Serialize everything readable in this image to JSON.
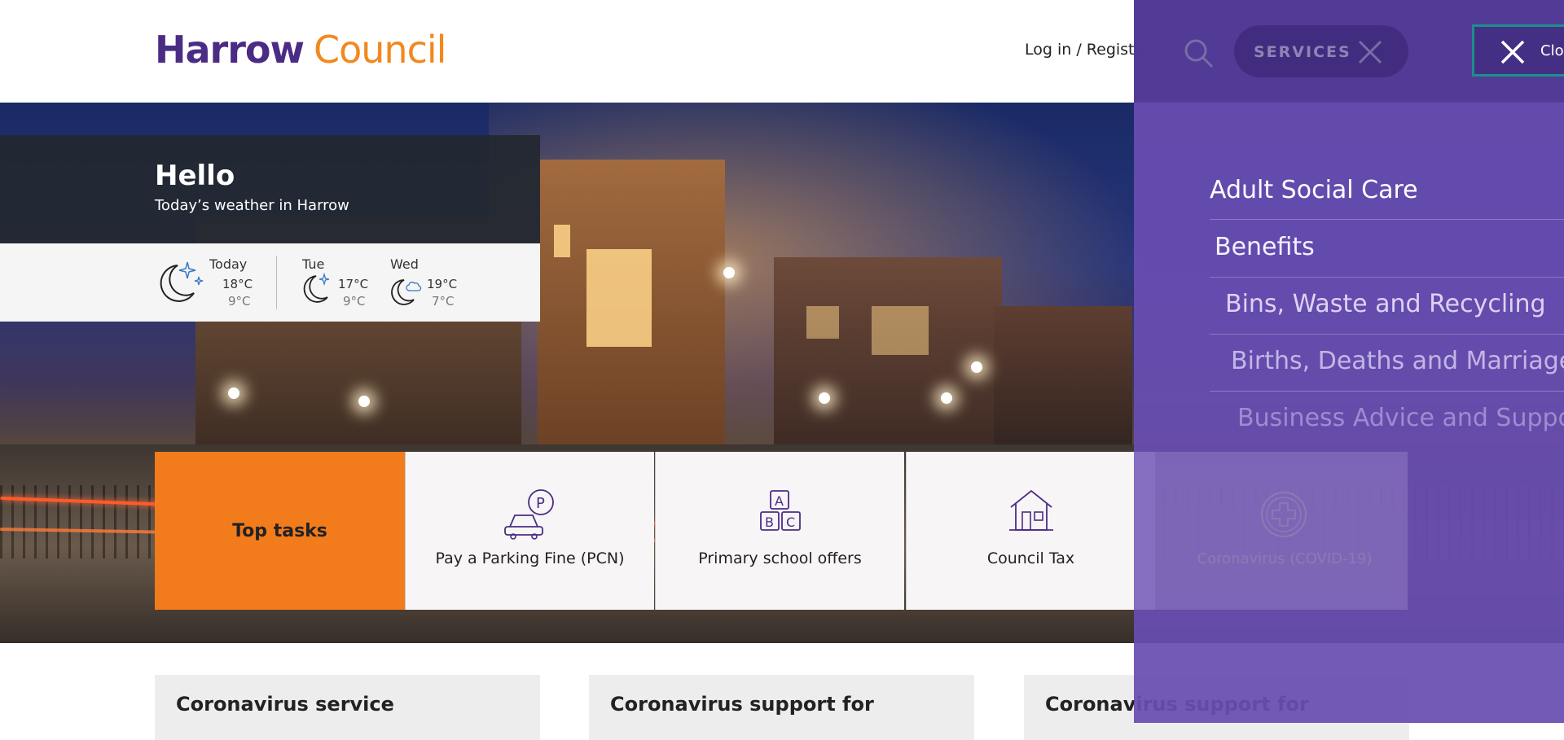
{
  "header": {
    "logo_harrow": "Harrow",
    "logo_council": "Council",
    "login": "Log in / Registe"
  },
  "greeting": {
    "title": "Hello",
    "subtitle": "Today’s weather in Harrow"
  },
  "weather": [
    {
      "day": "Today",
      "high": "18°C",
      "low": "9°C",
      "icon": "moon-stars-icon"
    },
    {
      "day": "Tue",
      "high": "17°C",
      "low": "9°C",
      "icon": "moon-stars-icon"
    },
    {
      "day": "Wed",
      "high": "19°C",
      "low": "7°C",
      "icon": "moon-cloud-icon"
    }
  ],
  "top_tasks": {
    "title": "Top tasks",
    "items": [
      {
        "label": "Pay a Parking Fine (PCN)",
        "icon": "parking-car-icon"
      },
      {
        "label": "Primary school offers",
        "icon": "abc-blocks-icon"
      },
      {
        "label": "Council Tax",
        "icon": "house-icon"
      },
      {
        "label": "Coronavirus (COVID-19)",
        "icon": "medical-cross-icon"
      }
    ]
  },
  "cards": [
    {
      "title": "Coronavirus service"
    },
    {
      "title": "Coronavirus support for"
    },
    {
      "title": "Coronavirus support for"
    }
  ],
  "services_menu": {
    "button_label": "SERVICES",
    "close_label": "Clo",
    "items": [
      "Adult Social Care",
      "Benefits",
      "Bins, Waste and Recycling",
      "Births, Deaths and Marriage",
      "Business Advice and Suppo"
    ]
  },
  "colors": {
    "brand_purple": "#4b2c85",
    "brand_orange": "#f2881e",
    "overlay_purple": "#684eb2",
    "top_tasks_orange": "#f27b1c"
  }
}
